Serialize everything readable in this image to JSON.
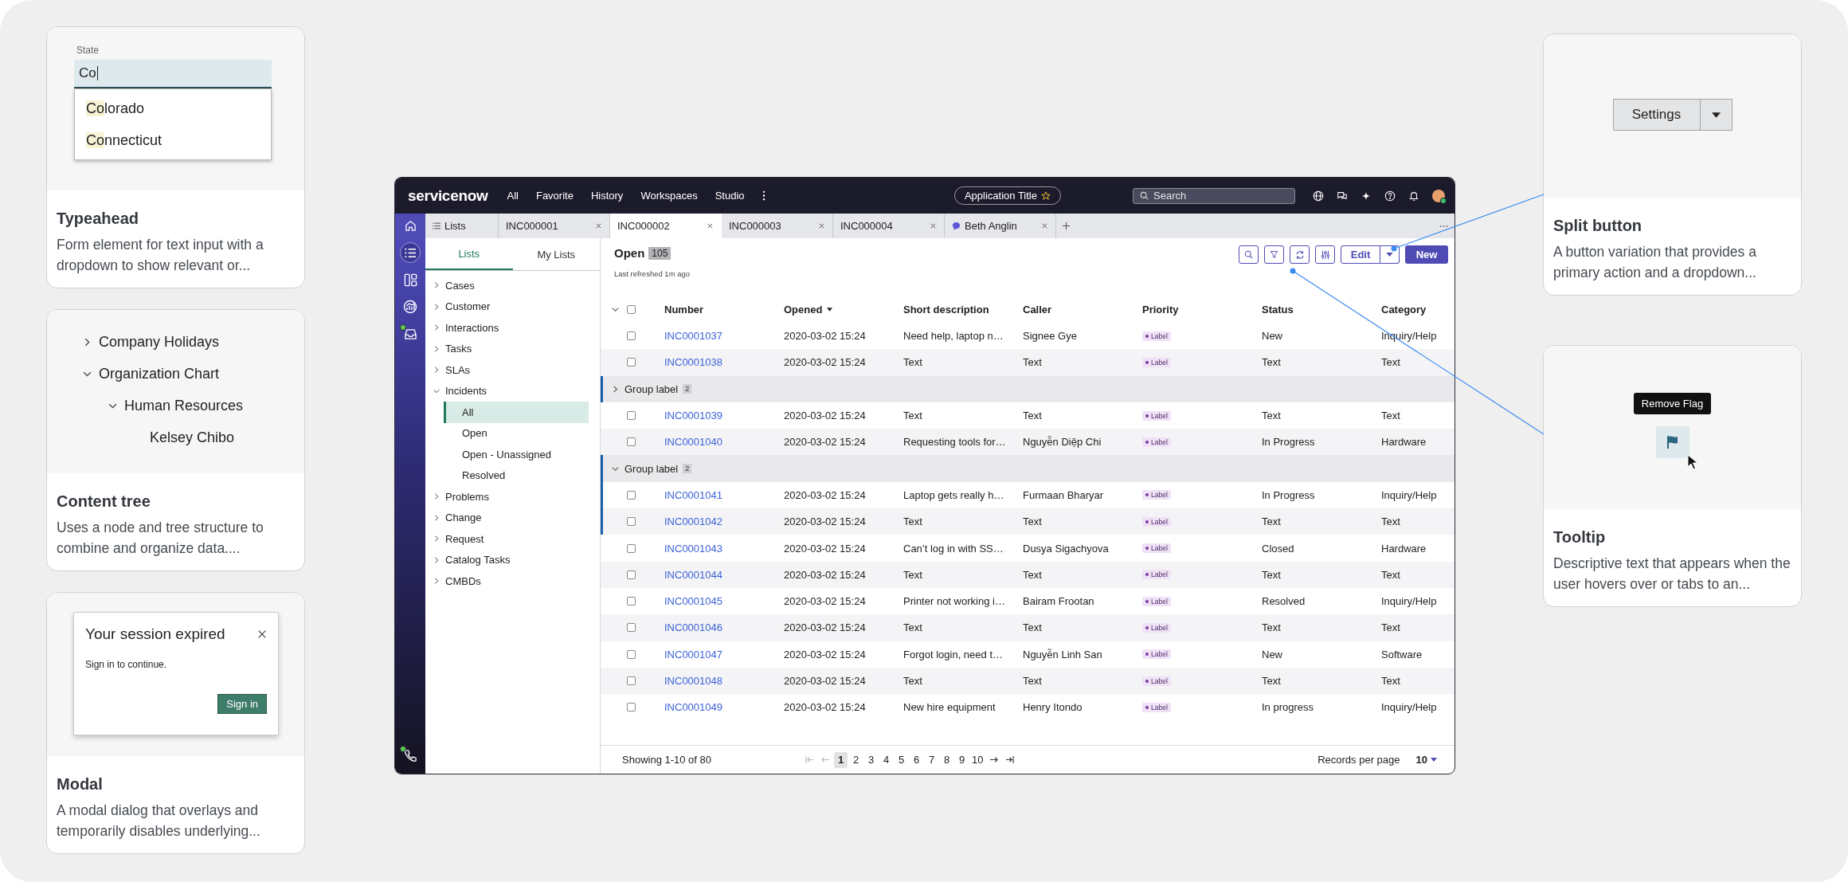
{
  "left_cards": [
    {
      "kind": "typeahead",
      "preview": {
        "label": "State",
        "value": "Co",
        "options": [
          {
            "match": "Co",
            "rest": "lorado"
          },
          {
            "match": "Co",
            "rest": "nnecticut"
          }
        ]
      },
      "title": "Typeahead",
      "description": "Form element for text input with a dropdown to show relevant or..."
    },
    {
      "kind": "tree",
      "preview": {
        "tree": [
          {
            "label": "Company Holidays",
            "expanded": false
          },
          {
            "label": "Organization Chart",
            "expanded": true,
            "children": [
              {
                "label": "Human Resources",
                "expanded": true,
                "children": [
                  {
                    "label": "Kelsey Chibo"
                  }
                ]
              }
            ]
          }
        ]
      },
      "title": "Content tree",
      "description": "Uses a node and tree structure to combine and organize data...."
    },
    {
      "kind": "modal",
      "preview": {
        "title": "Your session expired",
        "message": "Sign in to continue.",
        "button": "Sign in"
      },
      "title": "Modal",
      "description": "A modal dialog that overlays and temporarily disables underlying..."
    }
  ],
  "app": {
    "logo": "servicenow",
    "nav": [
      "All",
      "Favorite",
      "History",
      "Workspaces",
      "Studio"
    ],
    "app_title": "Application Title",
    "search_placeholder": "Search",
    "tabs": [
      {
        "kind": "list",
        "label": "Lists",
        "selected": false
      },
      {
        "kind": "record",
        "label": "INC000001",
        "selected": false
      },
      {
        "kind": "record",
        "label": "INC000002",
        "selected": true
      },
      {
        "kind": "record",
        "label": "INC000003",
        "selected": false
      },
      {
        "kind": "record",
        "label": "INC000004",
        "selected": false
      },
      {
        "kind": "chat",
        "label": "Beth Anglin",
        "selected": false
      }
    ],
    "rail": [
      {
        "kind": "list",
        "selected": true,
        "badge": false
      },
      {
        "kind": "dashboard",
        "selected": false,
        "badge": false
      },
      {
        "kind": "analytics",
        "selected": false,
        "badge": false
      },
      {
        "kind": "inbox",
        "selected": false,
        "badge": true
      },
      {
        "kind": "phone",
        "selected": false,
        "badge": true
      }
    ],
    "sidebar": {
      "tabs": [
        {
          "label": "Lists",
          "selected": true
        },
        {
          "label": "My Lists",
          "selected": false
        }
      ],
      "items": [
        {
          "label": "Cases",
          "expanded": false
        },
        {
          "label": "Customer",
          "expanded": false
        },
        {
          "label": "Interactions",
          "expanded": false
        },
        {
          "label": "Tasks",
          "expanded": false
        },
        {
          "label": "SLAs",
          "expanded": false
        },
        {
          "label": "Incidents",
          "expanded": true,
          "children": [
            {
              "label": "All",
              "selected": true
            },
            {
              "label": "Open",
              "selected": false
            },
            {
              "label": "Open - Unassigned",
              "selected": false
            },
            {
              "label": "Resolved",
              "selected": false
            }
          ]
        },
        {
          "label": "Problems",
          "expanded": false
        },
        {
          "label": "Change",
          "expanded": false
        },
        {
          "label": "Request",
          "expanded": false
        },
        {
          "label": "Catalog Tasks",
          "expanded": false
        },
        {
          "label": "CMBDs",
          "expanded": false
        }
      ]
    },
    "list": {
      "title": "Open",
      "count": "105",
      "refreshed": "Last refreshed 1m ago",
      "edit_button": "Edit",
      "new_button": "New",
      "select_all_checked": false,
      "columns": [
        {
          "label": "Number",
          "sorted": false
        },
        {
          "label": "Opened",
          "sorted": true
        },
        {
          "label": "Short description",
          "sorted": false
        },
        {
          "label": "Caller",
          "sorted": false
        },
        {
          "label": "Priority",
          "sorted": false
        },
        {
          "label": "Status",
          "sorted": false
        },
        {
          "label": "Category",
          "sorted": false
        }
      ],
      "rows": [
        {
          "kind": "record",
          "checked": false,
          "highlighted": false,
          "number": "INC0001037",
          "opened": "2020-03-02 15:24",
          "short_description": "Need help, laptop n…",
          "caller": "Signee Gye",
          "priority": "Label",
          "status": "New",
          "category": "Inquiry/Help"
        },
        {
          "kind": "record",
          "checked": false,
          "highlighted": false,
          "number": "INC0001038",
          "opened": "2020-03-02 15:24",
          "short_description": "Text",
          "caller": "Text",
          "priority": "Label",
          "status": "Text",
          "category": "Text"
        },
        {
          "kind": "group",
          "label": "Group label",
          "count": "2",
          "expanded": false
        },
        {
          "kind": "record",
          "checked": false,
          "highlighted": false,
          "number": "INC0001039",
          "opened": "2020-03-02 15:24",
          "short_description": "Text",
          "caller": "Text",
          "priority": "Label",
          "status": "Text",
          "category": "Text"
        },
        {
          "kind": "record",
          "checked": false,
          "highlighted": false,
          "number": "INC0001040",
          "opened": "2020-03-02 15:24",
          "short_description": "Requesting tools for…",
          "caller": "Nguyễn Diệp Chi",
          "priority": "Label",
          "status": "In Progress",
          "category": "Hardware"
        },
        {
          "kind": "group",
          "label": "Group label",
          "count": "2",
          "expanded": true
        },
        {
          "kind": "record",
          "checked": false,
          "highlighted": true,
          "number": "INC0001041",
          "opened": "2020-03-02 15:24",
          "short_description": "Laptop gets really h…",
          "caller": "Furmaan Bharyar",
          "priority": "Label",
          "status": "In Progress",
          "category": "Inquiry/Help"
        },
        {
          "kind": "record",
          "checked": false,
          "highlighted": true,
          "number": "INC0001042",
          "opened": "2020-03-02 15:24",
          "short_description": "Text",
          "caller": "Text",
          "priority": "Label",
          "status": "Text",
          "category": "Text"
        },
        {
          "kind": "record",
          "checked": false,
          "highlighted": false,
          "number": "INC0001043",
          "opened": "2020-03-02 15:24",
          "short_description": "Can’t log in with SS…",
          "caller": "Dusya Sigachyova",
          "priority": "Label",
          "status": "Closed",
          "category": "Hardware"
        },
        {
          "kind": "record",
          "checked": false,
          "highlighted": false,
          "number": "INC0001044",
          "opened": "2020-03-02 15:24",
          "short_description": "Text",
          "caller": "Text",
          "priority": "Label",
          "status": "Text",
          "category": "Text"
        },
        {
          "kind": "record",
          "checked": false,
          "highlighted": false,
          "number": "INC0001045",
          "opened": "2020-03-02 15:24",
          "short_description": "Printer not working i…",
          "caller": "Bairam Frootan",
          "priority": "Label",
          "status": "Resolved",
          "category": "Inquiry/Help"
        },
        {
          "kind": "record",
          "checked": false,
          "highlighted": false,
          "number": "INC0001046",
          "opened": "2020-03-02 15:24",
          "short_description": "Text",
          "caller": "Text",
          "priority": "Label",
          "status": "Text",
          "category": "Text"
        },
        {
          "kind": "record",
          "checked": false,
          "highlighted": false,
          "number": "INC0001047",
          "opened": "2020-03-02 15:24",
          "short_description": "Forgot login, need t…",
          "caller": "Nguyễn Linh San",
          "priority": "Label",
          "status": "New",
          "category": "Software"
        },
        {
          "kind": "record",
          "checked": false,
          "highlighted": false,
          "number": "INC0001048",
          "opened": "2020-03-02 15:24",
          "short_description": "Text",
          "caller": "Text",
          "priority": "Label",
          "status": "Text",
          "category": "Text"
        },
        {
          "kind": "record",
          "checked": false,
          "highlighted": false,
          "number": "INC0001049",
          "opened": "2020-03-02 15:24",
          "short_description": "New hire equipment",
          "caller": "Henry Itondo",
          "priority": "Label",
          "status": "In progress",
          "category": "Inquiry/Help"
        }
      ],
      "footer": {
        "showing": "Showing 1-10 of 80",
        "nav_back": [
          {
            "kind": "first",
            "disabled": true
          },
          {
            "kind": "prev",
            "disabled": true
          }
        ],
        "pages": [
          {
            "label": "1",
            "selected": true
          },
          {
            "label": "2",
            "selected": false
          },
          {
            "label": "3",
            "selected": false
          },
          {
            "label": "4",
            "selected": false
          },
          {
            "label": "5",
            "selected": false
          },
          {
            "label": "6",
            "selected": false
          },
          {
            "label": "7",
            "selected": false
          },
          {
            "label": "8",
            "selected": false
          },
          {
            "label": "9",
            "selected": false
          },
          {
            "label": "10",
            "selected": false
          }
        ],
        "nav_forward": [
          {
            "kind": "next",
            "disabled": false
          },
          {
            "kind": "last",
            "disabled": false
          }
        ],
        "per_page_label": "Records per page",
        "per_page": "10"
      }
    }
  },
  "right_cards": [
    {
      "kind": "split_button",
      "preview": {
        "button": "Settings"
      },
      "title": "Split button",
      "description": "A button variation that provides a primary action and a dropdown..."
    },
    {
      "kind": "tooltip",
      "preview": {
        "tooltip": "Remove Flag"
      },
      "title": "Tooltip",
      "description": "Descriptive text that appears when the user hovers over or tabs to an..."
    }
  ]
}
